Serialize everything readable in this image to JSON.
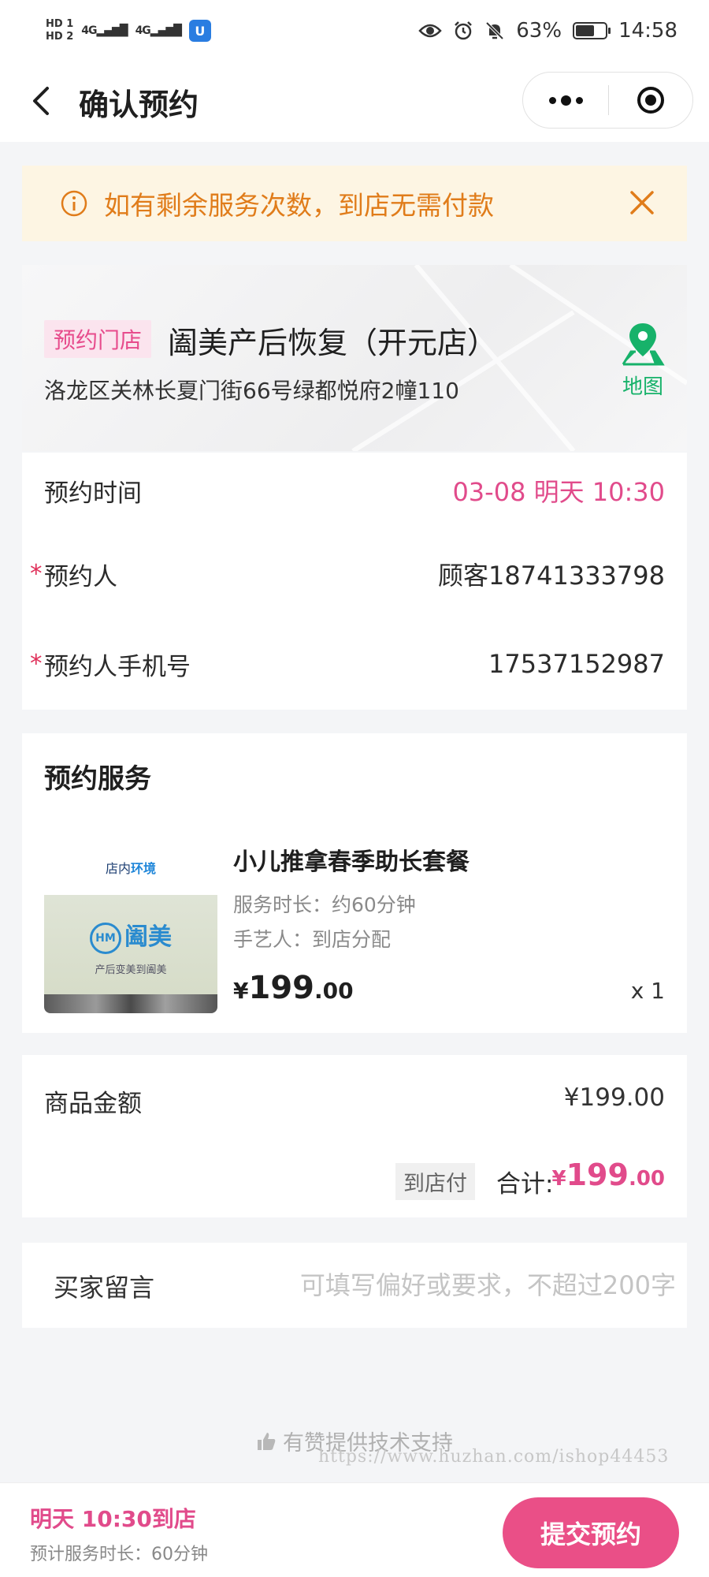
{
  "status_bar": {
    "hd1": "HD 1",
    "hd2": "HD 2",
    "net1": "4G",
    "net2": "4G",
    "app_badge": "U",
    "battery_text": "63%",
    "battery_level": 0.63,
    "time": "14:58"
  },
  "nav": {
    "title": "确认预约"
  },
  "notice": {
    "text": "如有剩余服务次数，到店无需付款"
  },
  "store": {
    "tag": "预约门店",
    "name": "阖美产后恢复（开元店）",
    "address": "洛龙区关林长夏门街66号绿都悦府2幢110",
    "map_label": "地图"
  },
  "booking": {
    "time_label": "预约时间",
    "time_value": "03-08 明天 10:30",
    "person_label": "预约人",
    "person_value": "顾客18741333798",
    "phone_label": "预约人手机号",
    "phone_value": "17537152987",
    "required_mark": "*"
  },
  "service": {
    "section_title": "预约服务",
    "thumb_head_a": "店内",
    "thumb_head_b": "环境",
    "thumb_logo": "阖美",
    "thumb_logo_mark": "HM",
    "thumb_slogan": "产后变美到阖美",
    "name": "小儿推拿春季助长套餐",
    "duration": "服务时长：约60分钟",
    "artisan": "手艺人：到店分配",
    "price_currency": "¥",
    "price_int": "199",
    "price_dec": ".00",
    "qty": "x 1"
  },
  "amount": {
    "label": "商品金额",
    "value": "¥199.00",
    "pay_tag": "到店付",
    "total_label": "合计:",
    "total_currency": "¥",
    "total_int": "199",
    "total_dec": ".00"
  },
  "message": {
    "label": "买家留言",
    "placeholder": "可填写偏好或要求，不超过200字"
  },
  "footer": {
    "support_text": "有赞提供技术支持",
    "watermark": "https://www.huzhan.com/ishop44453"
  },
  "bottom_bar": {
    "time_text": "明天 10:30到店",
    "duration_text": "预计服务时长：60分钟",
    "submit_label": "提交预约"
  },
  "colors": {
    "accent": "#e14b8b",
    "notice_bg": "#fdf5e3",
    "notice_text": "#e07c1a",
    "map_green": "#17b26a"
  }
}
